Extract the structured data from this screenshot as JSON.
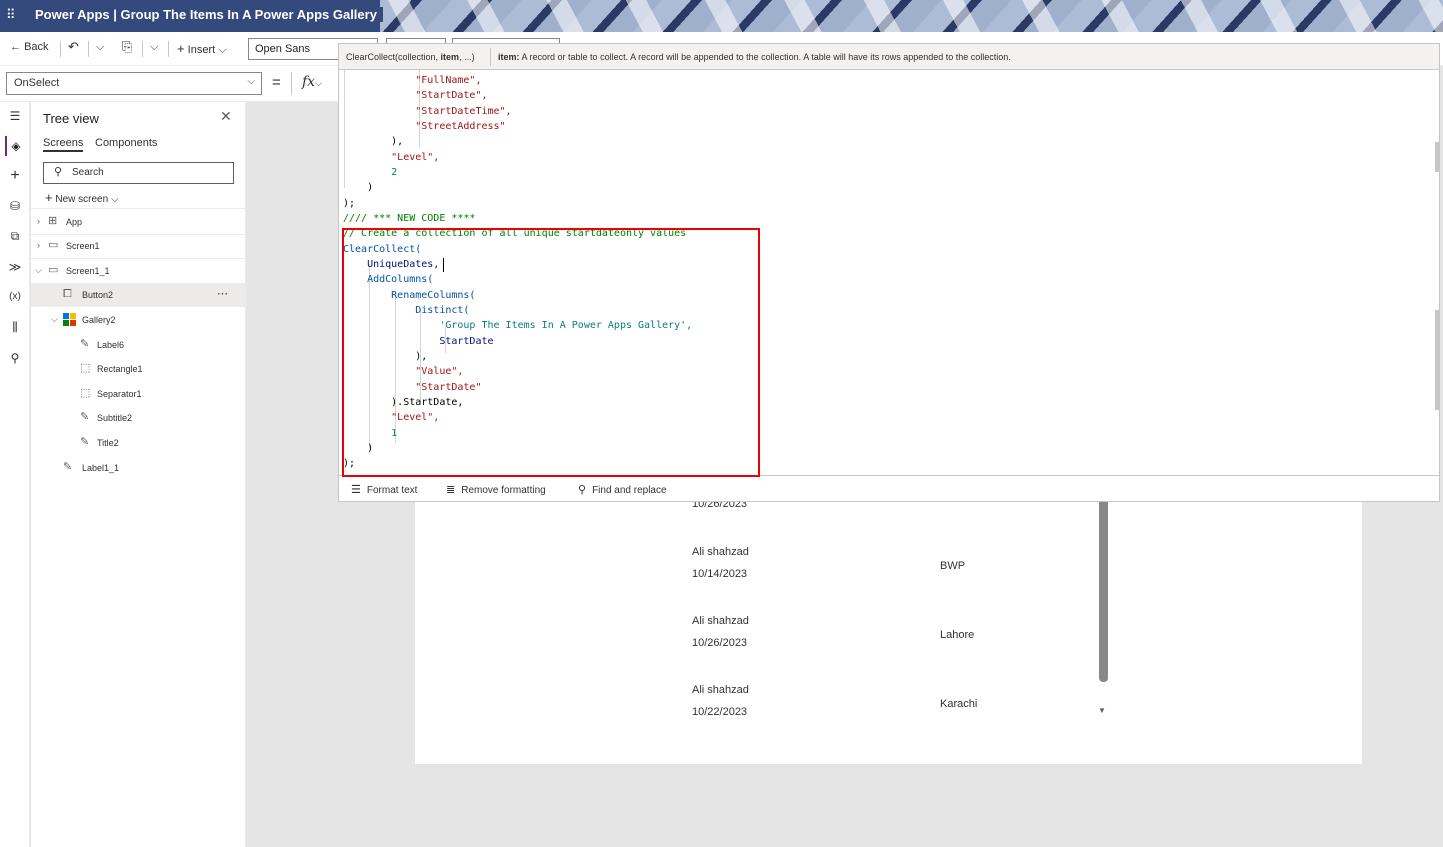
{
  "titlebar": {
    "title": "Power Apps  |  Group The Items In A Power Apps Gallery"
  },
  "toolbar": {
    "back_label": "Back",
    "insert_label": "Insert",
    "font_value": "Open Sans"
  },
  "formula": {
    "property": "OnSelect",
    "equals": "=",
    "fx_label": "fx",
    "hint_signature_pre": "ClearCollect(collection, ",
    "hint_signature_bold": "item",
    "hint_signature_post": ", ...)",
    "hint_param_bold": "item:",
    "hint_param_desc": " A record or table to collect. A record will be appended to the collection. A table will have its rows appended to the collection.",
    "format_text": "Format text",
    "remove_formatting": "Remove formatting",
    "find_replace": "Find and replace"
  },
  "code_lines": [
    "            \"FullName\",",
    "            \"StartDate\",",
    "            \"StartDateTime\",",
    "            \"StreetAddress\"",
    "        ),",
    "        \"Level\",",
    "        2",
    "    )",
    ");",
    "//// *** NEW CODE ****",
    "// Create a collection of all unique startdateonly values",
    "ClearCollect(",
    "    UniqueDates,",
    "    AddColumns(",
    "        RenameColumns(",
    "            Distinct(",
    "                'Group The Items In A Power Apps Gallery',",
    "                StartDate",
    "            ),",
    "            \"Value\",",
    "            \"StartDate\"",
    "        ).StartDate,",
    "        \"Level\",",
    "        1",
    "    )",
    ");"
  ],
  "treeview": {
    "title": "Tree view",
    "tab_screens": "Screens",
    "tab_components": "Components",
    "search_placeholder": "Search",
    "new_screen": "New screen",
    "nodes": {
      "app": "App",
      "screen1": "Screen1",
      "screen1_1": "Screen1_1",
      "button2": "Button2",
      "gallery2": "Gallery2",
      "label6": "Label6",
      "rectangle1": "Rectangle1",
      "separator1": "Separator1",
      "subtitle2": "Subtitle2",
      "title2": "Title2",
      "label1_1": "Label1_1"
    },
    "more": "⋯"
  },
  "gallery": {
    "partial_date": "10/26/2023",
    "rows": [
      {
        "name": "Ali shahzad",
        "date": "10/14/2023",
        "city": "BWP"
      },
      {
        "name": "Ali shahzad",
        "date": "10/26/2023",
        "city": "Lahore"
      },
      {
        "name": "Ali shahzad",
        "date": "10/22/2023",
        "city": "Karachi"
      }
    ]
  },
  "icons": {
    "waffle": "⠿",
    "back": "←",
    "undo": "↶",
    "chevron": "⌵",
    "paste": "📋",
    "plus": "+",
    "search": "⚲",
    "close": "✕"
  }
}
